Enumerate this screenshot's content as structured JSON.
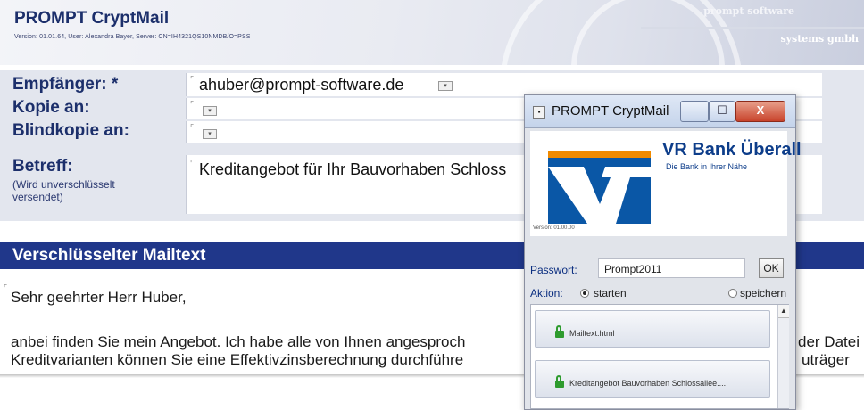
{
  "header": {
    "title": "PROMPT CryptMail",
    "version_line": "Version: 01.01.64, User: Alexandra Bayer, Server: CN=IH4321QS10NMDB/O=PSS",
    "logo_top": "prompt software",
    "logo_bottom": "systems gmbh"
  },
  "form": {
    "to_label": "Empfänger: *",
    "to_value": "ahuber@prompt-software.de",
    "cc_label": "Kopie an:",
    "cc_value": "",
    "bcc_label": "Blindkopie an:",
    "bcc_value": "",
    "subject_label": "Betreff:",
    "subject_note": "(Wird unverschlüsselt versendet)",
    "subject_value": "Kreditangebot für Ihr Bauvorhaben Schloss"
  },
  "body": {
    "section_title": "Verschlüsselter Mailtext",
    "greeting": "Sehr geehrter Herr Huber,",
    "line1": "anbei finden Sie mein Angebot. Ich habe alle von Ihnen angesproch",
    "line2": "Kreditvarianten können Sie eine Effektivzinsberechnung durchführe",
    "line1_end": "der Datei",
    "line2_end": "uträger"
  },
  "dialog": {
    "title": "PROMPT CryptMail",
    "min_glyph": "—",
    "max_glyph": "☐",
    "close_glyph": "X",
    "bank_name": "VR Bank Überall",
    "bank_slogan": "Die Bank in Ihrer Nähe",
    "version": "Version: 01.00.00",
    "password_label": "Passwort:",
    "password_value": "Prompt2011",
    "ok_label": "OK",
    "action_label": "Aktion:",
    "option_start": "starten",
    "option_save": "speichern",
    "selected_action": "starten",
    "attachments": [
      "Mailtext.html",
      "Kreditangebot Bauvorhaben Schlossallee...."
    ],
    "scroll_up_glyph": "▲"
  },
  "colors": {
    "accent": "#20378a",
    "label": "#1c2f6b",
    "bank_blue": "#0a57a6"
  }
}
